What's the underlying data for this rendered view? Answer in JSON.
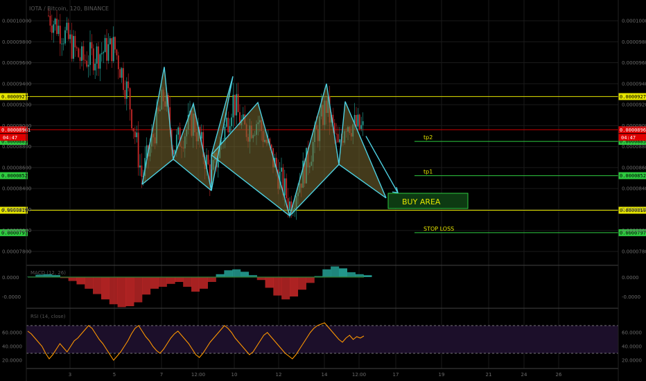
{
  "title": "IOTA / Bitcoin, 120, BINANCE",
  "countdown": "04:47",
  "colors": {
    "background": "#000000",
    "grid": "#1a1a1a",
    "bull": "#26a69a",
    "bear": "#c62828",
    "pattern_line": "#4dd0e1",
    "pattern_fill": "#7a6a32",
    "yellow": "#e6e600",
    "green_level": "#2ecc40",
    "red_level": "#cc0000",
    "rsi_line": "#ff9800",
    "rsi_band": "#1c0f2a"
  },
  "chart_data": [
    {
      "type": "candlestick",
      "title": "IOTA / Bitcoin, 120, BINANCE",
      "y_ticks": [
        "0.00010000",
        "0.00009800",
        "0.00009600",
        "0.00009400",
        "0.00009200",
        "0.00009000",
        "0.00008800",
        "0.00008600",
        "0.00008400",
        "0.00008200",
        "0.00008000",
        "0.00007800"
      ],
      "x_ticks": [
        "3",
        "5",
        "7",
        "12:00",
        "10",
        "12",
        "14",
        "12:00",
        "17",
        "19",
        "21",
        "24",
        "26"
      ],
      "levels": [
        {
          "value": "0.00009277",
          "style": "yellow"
        },
        {
          "value": "0.00008961",
          "style": "red"
        },
        {
          "value": "0.00008850",
          "style": "green"
        },
        {
          "value": "0.00008523",
          "style": "green"
        },
        {
          "value": "0.00008193",
          "style": "yellow"
        },
        {
          "value": "0.00007979",
          "style": "green"
        }
      ],
      "annotations": [
        {
          "text": "tp2"
        },
        {
          "text": "tp1"
        },
        {
          "text": "BUY AREA"
        },
        {
          "text": "STOP LOSS"
        }
      ],
      "pattern": {
        "points": [
          {
            "x_tick": "5",
            "y": 8.44e-05
          },
          {
            "x_tick": "7",
            "y": 9.56e-05
          },
          {
            "x_tick": "7",
            "y": 8.68e-05
          },
          {
            "x_tick": "12:00",
            "y": 9.21e-05
          },
          {
            "x_tick": "10",
            "y": 8.38e-05
          },
          {
            "x_tick": "10",
            "y": 9.47e-05
          },
          {
            "x_tick": "10",
            "y": 8.72e-05
          },
          {
            "x_tick": "12",
            "y": 9.22e-05
          },
          {
            "x_tick": "12",
            "y": 8.14e-05
          },
          {
            "x_tick": "14",
            "y": 9.4e-05
          },
          {
            "x_tick": "14",
            "y": 8.63e-05
          },
          {
            "x_tick": "12:00",
            "y": 9.23e-05
          },
          {
            "x_tick": "12:00",
            "y": 8.31e-05
          }
        ]
      },
      "projection_arrow": {
        "from": {
          "x_tick": "12:00",
          "y": 8.9e-05
        },
        "to": {
          "x_tick": "17",
          "y": 8.36e-05
        }
      }
    },
    {
      "type": "histogram",
      "name": "MACD (12, 26)",
      "y_ticks": [
        "0.0000",
        "-0.0000"
      ],
      "values": [
        0.1,
        0.5,
        0.6,
        0.4,
        -0.2,
        -0.8,
        -1.5,
        -2.4,
        -3.5,
        -4.6,
        -5.6,
        -6.2,
        -6.0,
        -5.2,
        -3.6,
        -2.4,
        -2.0,
        -1.4,
        -1.0,
        -2.0,
        -3.0,
        -2.4,
        -1.0,
        0.6,
        1.4,
        1.6,
        1.1,
        0.4,
        -0.6,
        -2.2,
        -3.8,
        -4.6,
        -4.0,
        -2.6,
        -1.2,
        0.2,
        1.6,
        2.2,
        1.8,
        1.0,
        0.6,
        0.4
      ]
    },
    {
      "type": "line",
      "name": "RSI (14, close)",
      "y_ticks": [
        "60.0000",
        "40.0000",
        "20.0000"
      ],
      "ylim": [
        10,
        90
      ],
      "bands": [
        70,
        30
      ],
      "values": [
        62,
        58,
        52,
        46,
        40,
        30,
        22,
        28,
        36,
        44,
        38,
        32,
        40,
        48,
        52,
        58,
        64,
        70,
        66,
        58,
        50,
        44,
        36,
        28,
        20,
        26,
        32,
        40,
        48,
        58,
        66,
        70,
        62,
        54,
        48,
        40,
        34,
        30,
        36,
        44,
        52,
        58,
        62,
        56,
        50,
        44,
        36,
        28,
        24,
        30,
        38,
        46,
        52,
        58,
        64,
        70,
        66,
        60,
        52,
        46,
        40,
        34,
        28,
        32,
        40,
        48,
        56,
        60,
        54,
        48,
        42,
        36,
        30,
        26,
        22,
        28,
        36,
        44,
        52,
        60,
        66,
        70,
        72,
        74,
        68,
        62,
        56,
        50,
        46,
        52,
        56,
        50,
        54,
        52,
        55
      ]
    }
  ]
}
